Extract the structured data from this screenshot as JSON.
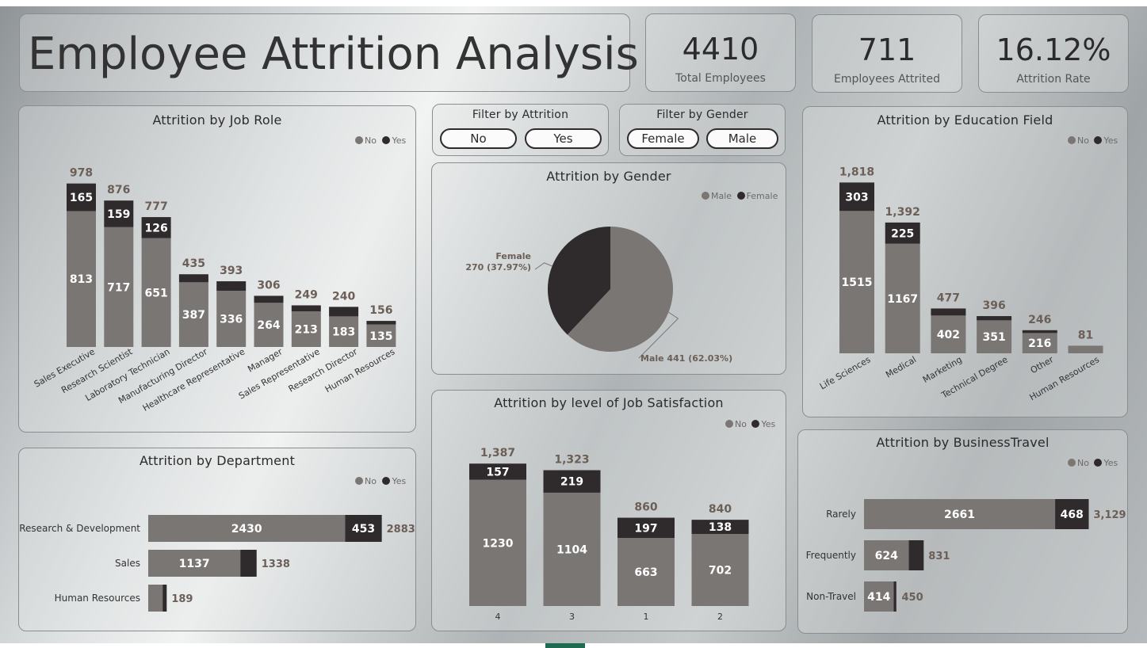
{
  "title": "Employee Attrition Analysis",
  "kpis": [
    {
      "value": "4410",
      "label": "Total Employees"
    },
    {
      "value": "711",
      "label": "Employees Attrited"
    },
    {
      "value": "16.12%",
      "label": "Attrition Rate"
    }
  ],
  "filters": {
    "attrition": {
      "title": "Filter by Attrition",
      "options": [
        "No",
        "Yes"
      ]
    },
    "gender": {
      "title": "Filter by Gender",
      "options": [
        "Female",
        "Male"
      ]
    }
  },
  "legend": {
    "no": "No",
    "yes": "Yes",
    "male": "Male",
    "female": "Female"
  },
  "colors": {
    "no": "#7a7674",
    "yes": "#2f2a2b",
    "total": "#5a5656",
    "header_total": "#6b5f57"
  },
  "chart_data": [
    {
      "id": "job_role",
      "title": "Attrition by Job Role",
      "type": "bar",
      "stacked": true,
      "categories": [
        "Sales Executive",
        "Research Scientist",
        "Laboratory Technician",
        "Manufacturing Director",
        "Healthcare Representative",
        "Manager",
        "Sales Representative",
        "Research Director",
        "Human Resources"
      ],
      "series": [
        {
          "name": "No",
          "values": [
            813,
            717,
            651,
            387,
            336,
            264,
            213,
            183,
            135
          ]
        },
        {
          "name": "Yes",
          "values": [
            165,
            159,
            126,
            48,
            57,
            42,
            36,
            57,
            21
          ]
        }
      ],
      "totals": [
        978,
        876,
        777,
        435,
        393,
        306,
        249,
        240,
        156
      ],
      "yes_labels": [
        "165",
        "159",
        "126",
        "",
        "",
        "",
        "",
        "",
        ""
      ]
    },
    {
      "id": "gender",
      "title": "Attrition by Gender",
      "type": "pie",
      "slices": [
        {
          "name": "Male",
          "value": 441,
          "label": "Male 441 (62.03%)"
        },
        {
          "name": "Female",
          "value": 270,
          "label_name": "Female",
          "label": "270 (37.97%)"
        }
      ]
    },
    {
      "id": "education",
      "title": "Attrition by Education Field",
      "type": "bar",
      "stacked": true,
      "categories": [
        "Life Sciences",
        "Medical",
        "Marketing",
        "Technical Degree",
        "Other",
        "Human Resources"
      ],
      "series": [
        {
          "name": "No",
          "values": [
            1515,
            1167,
            402,
            351,
            216,
            81
          ]
        },
        {
          "name": "Yes",
          "values": [
            303,
            225,
            75,
            45,
            30,
            0
          ]
        }
      ],
      "totals": [
        "1,818",
        "1,392",
        "477",
        "396",
        "246",
        "81"
      ],
      "total_values": [
        1818,
        1392,
        477,
        396,
        246,
        81
      ],
      "no_labels": [
        "1515",
        "1167",
        "402",
        "351",
        "216",
        ""
      ],
      "yes_labels": [
        "303",
        "225",
        "",
        "",
        "",
        ""
      ]
    },
    {
      "id": "department",
      "title": "Attrition by Department",
      "type": "bar",
      "orientation": "horizontal",
      "stacked": true,
      "categories": [
        "Research & Development",
        "Sales",
        "Human Resources"
      ],
      "series": [
        {
          "name": "No",
          "values": [
            2430,
            1137,
            189
          ]
        },
        {
          "name": "Yes",
          "values": [
            453,
            201,
            0
          ]
        }
      ],
      "totals": [
        "2883",
        "1338",
        "189"
      ],
      "total_values": [
        2883,
        1338,
        189
      ],
      "no_labels": [
        "2430",
        "1137",
        ""
      ],
      "yes_labels": [
        "453",
        "",
        ""
      ]
    },
    {
      "id": "job_satisfaction",
      "title": "Attrition by level of Job Satisfaction",
      "type": "bar",
      "stacked": true,
      "categories": [
        "4",
        "3",
        "1",
        "2"
      ],
      "series": [
        {
          "name": "No",
          "values": [
            1230,
            1104,
            663,
            702
          ]
        },
        {
          "name": "Yes",
          "values": [
            157,
            219,
            197,
            138
          ]
        }
      ],
      "totals": [
        "1,387",
        "1,323",
        "860",
        "840"
      ],
      "total_values": [
        1387,
        1323,
        860,
        840
      ]
    },
    {
      "id": "business_travel",
      "title": "Attrition by BusinessTravel",
      "type": "bar",
      "orientation": "horizontal",
      "stacked": true,
      "categories": [
        "Rarely",
        "Frequently",
        "Non-Travel"
      ],
      "series": [
        {
          "name": "No",
          "values": [
            2661,
            624,
            414
          ]
        },
        {
          "name": "Yes",
          "values": [
            468,
            207,
            36
          ]
        }
      ],
      "totals": [
        "3,129",
        "831",
        "450"
      ],
      "total_values": [
        3129,
        831,
        450
      ],
      "yes_labels": [
        "468",
        "",
        ""
      ]
    }
  ]
}
